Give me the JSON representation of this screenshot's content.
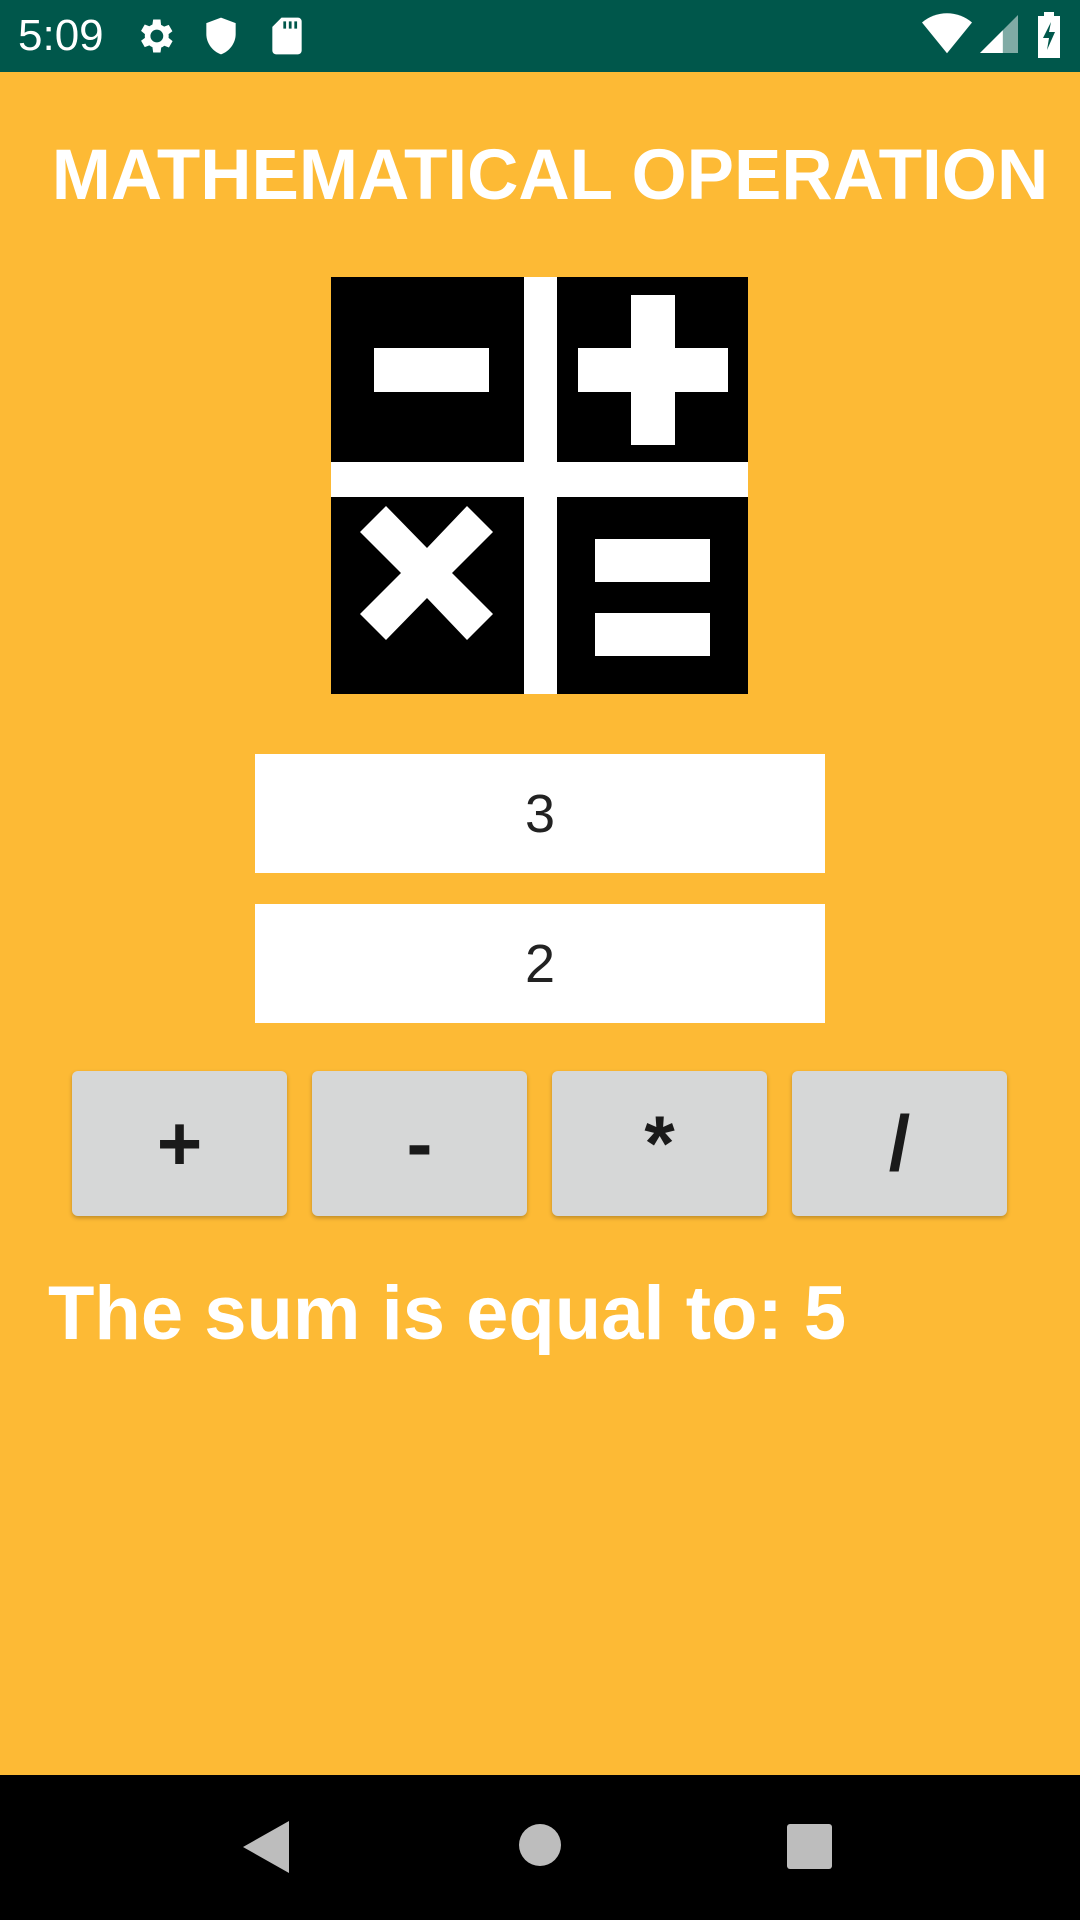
{
  "status_bar": {
    "time": "5:09",
    "icons": [
      "gear-icon",
      "shield-icon",
      "sd-card-icon",
      "wifi-icon",
      "signal-icon",
      "battery-charging-icon"
    ]
  },
  "app": {
    "title": "MATHEMATICAL OPERATION",
    "first_number": "3",
    "second_number": "2",
    "operations": [
      "+",
      "-",
      "*",
      "/"
    ],
    "result_text": "The sum is equal to: 5",
    "colors": {
      "background": "#FDBA35",
      "status_bar": "#00574B",
      "button": "#D6D7D7",
      "text": "#FFFFFF"
    }
  },
  "nav_bar": {
    "buttons": [
      "back-icon",
      "home-icon",
      "recents-icon"
    ]
  }
}
